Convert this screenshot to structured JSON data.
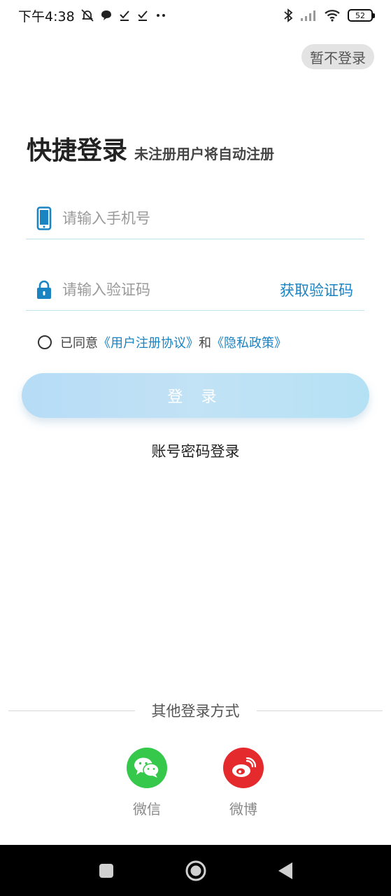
{
  "status_bar": {
    "time": "下午4:38",
    "battery": "52"
  },
  "header": {
    "skip_label": "暂不登录"
  },
  "title": {
    "main": "快捷登录",
    "sub": "未注册用户将自动注册"
  },
  "form": {
    "phone_placeholder": "请输入手机号",
    "code_placeholder": "请输入验证码",
    "get_code_label": "获取验证码"
  },
  "agreement": {
    "prefix": "已同意",
    "user_agreement": "《用户注册协议》",
    "and": "和",
    "privacy": "《隐私政策》"
  },
  "login_button_label": "登 录",
  "password_login_label": "账号密码登录",
  "other_login": {
    "title": "其他登录方式",
    "wechat_label": "微信",
    "weibo_label": "微博"
  },
  "colors": {
    "accent": "#1a83c2",
    "wechat": "#36c84b",
    "weibo": "#e52a2e"
  }
}
